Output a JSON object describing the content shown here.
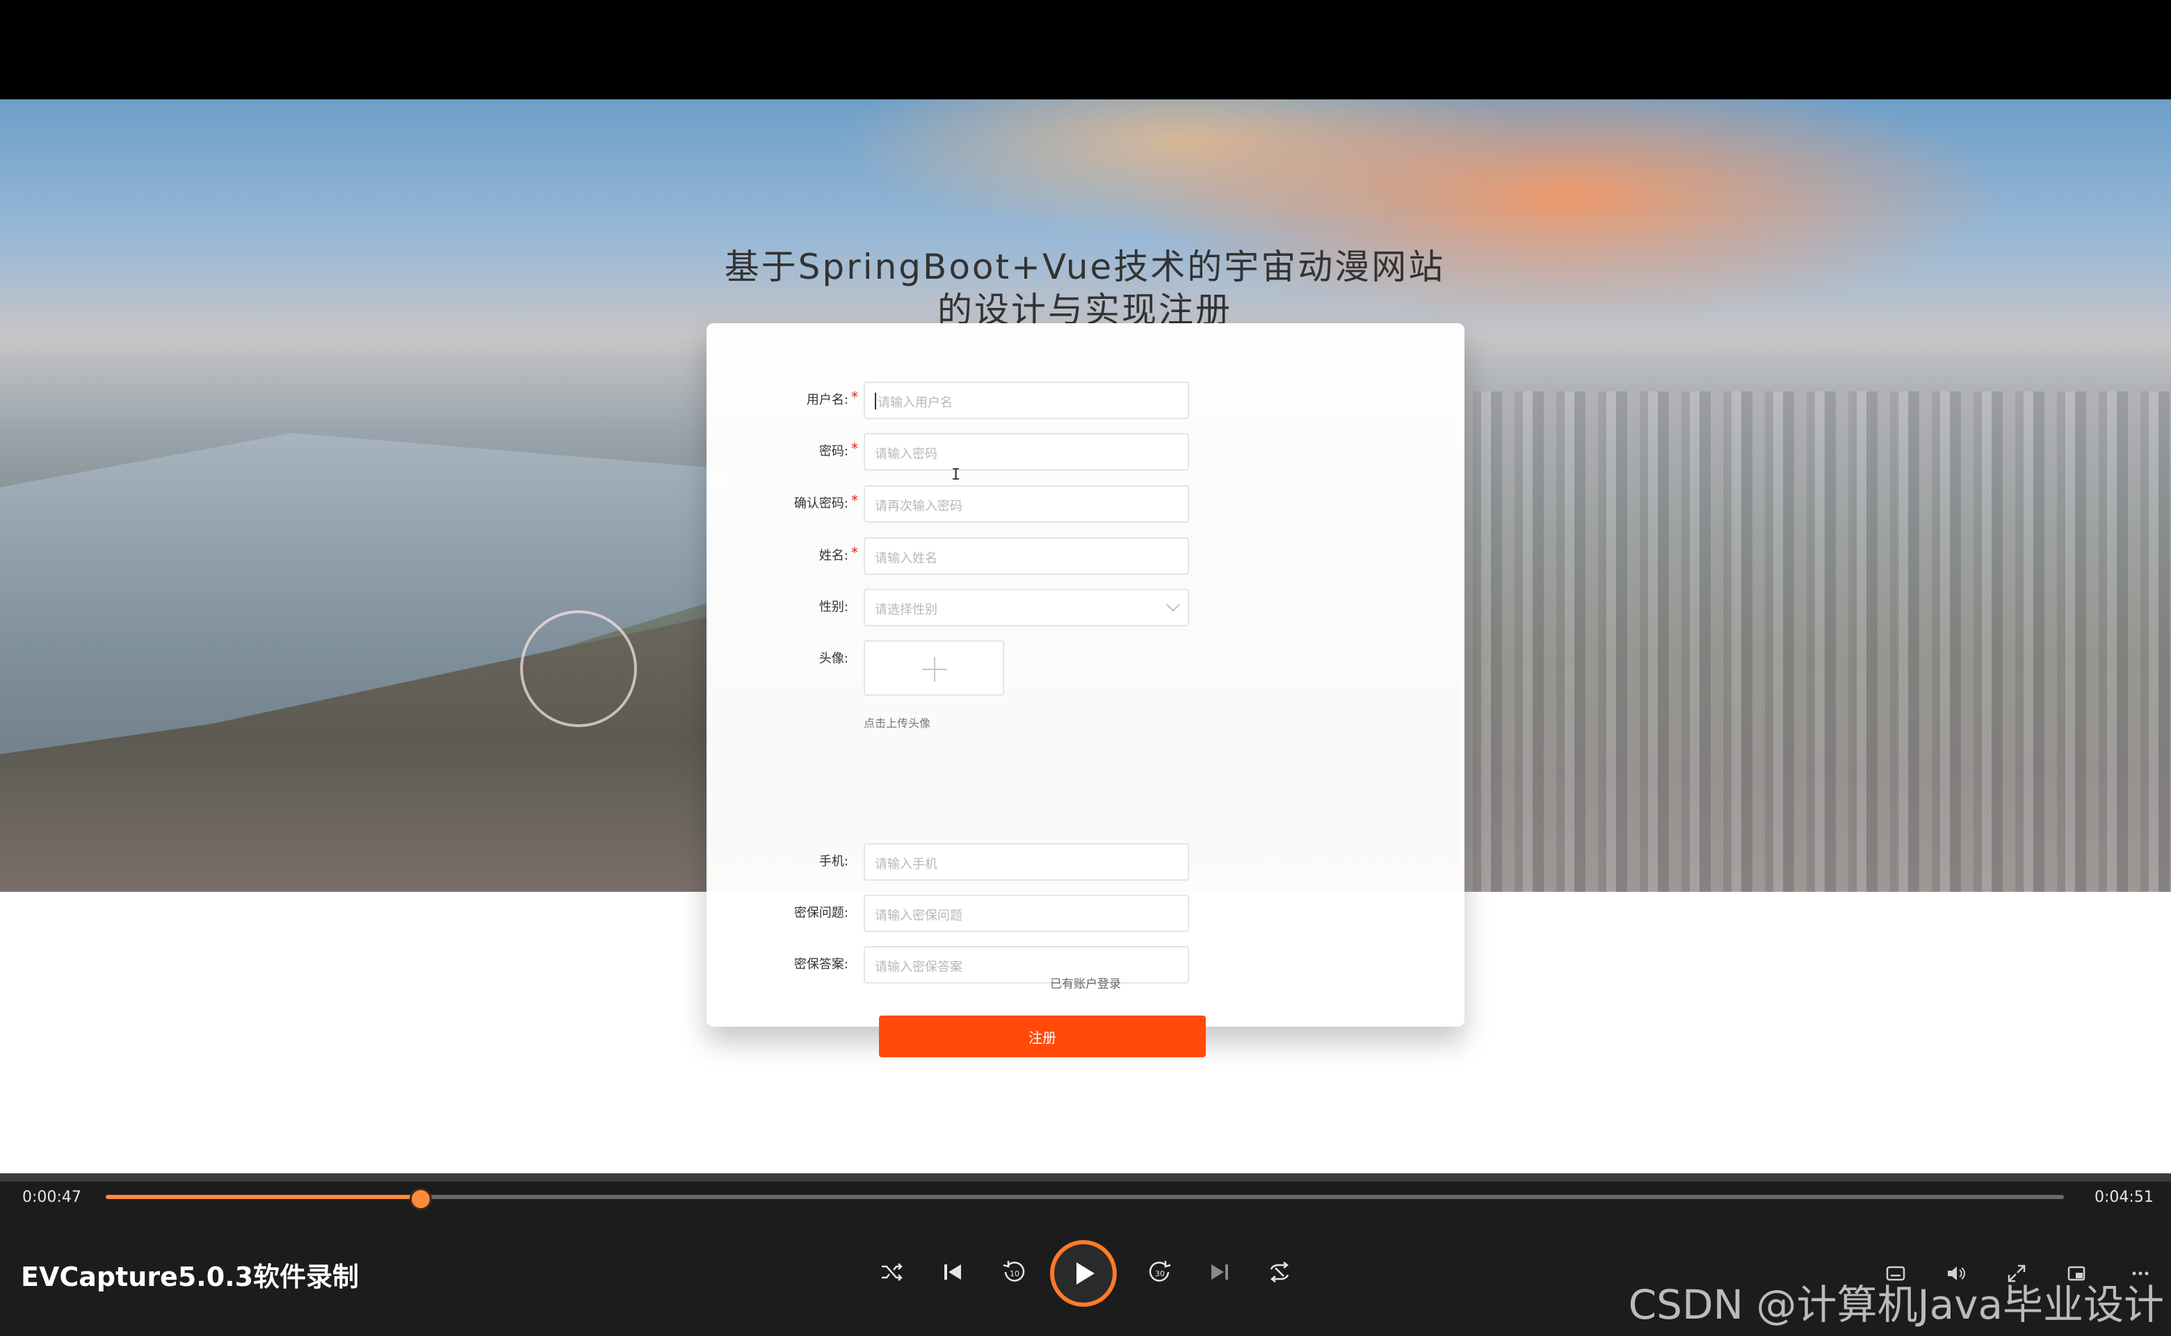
{
  "page": {
    "title": "基于SpringBoot+Vue技术的宇宙动漫网站\n的设计与实现注册"
  },
  "form": {
    "fields": [
      {
        "label": "用户名:",
        "required": true,
        "placeholder": "请输入用户名"
      },
      {
        "label": "密码:",
        "required": true,
        "placeholder": "请输入密码"
      },
      {
        "label": "确认密码:",
        "required": true,
        "placeholder": "请再次输入密码"
      },
      {
        "label": "姓名:",
        "required": true,
        "placeholder": "请输入姓名"
      },
      {
        "label": "性别:",
        "required": false,
        "placeholder": "请选择性别"
      },
      {
        "label": "头像:",
        "required": false,
        "hint": "点击上传头像"
      },
      {
        "label": "手机:",
        "required": false,
        "placeholder": "请输入手机"
      },
      {
        "label": "密保问题:",
        "required": false,
        "placeholder": "请输入密保问题"
      },
      {
        "label": "密保答案:",
        "required": false,
        "placeholder": "请输入密保答案"
      }
    ],
    "required_mark": "*",
    "submit_label": "注册",
    "login_link": "已有账户登录"
  },
  "player": {
    "current_time": "0:00:47",
    "total_time": "0:04:51",
    "progress": 0.16,
    "app_name": "EVCapture5.0.3软件录制",
    "watermark": "CSDN @计算机Java毕业设计"
  },
  "colors": {
    "accent": "#ff4a0a",
    "progress": "#ff8a3a"
  }
}
